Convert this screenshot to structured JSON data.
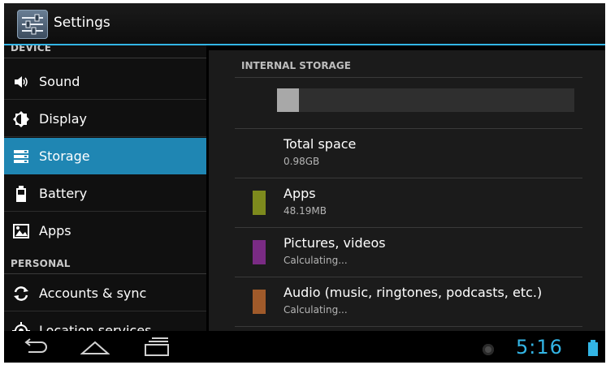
{
  "app": {
    "title": "Settings",
    "icon": "settings-sliders-icon"
  },
  "sidebar": {
    "sections": [
      {
        "header": "DEVICE"
      },
      {
        "header": "PERSONAL"
      }
    ],
    "items": [
      {
        "label": "Sound",
        "icon": "speaker-icon"
      },
      {
        "label": "Display",
        "icon": "brightness-icon"
      },
      {
        "label": "Storage",
        "icon": "storage-icon",
        "selected": true
      },
      {
        "label": "Battery",
        "icon": "battery-icon"
      },
      {
        "label": "Apps",
        "icon": "apps-icon"
      },
      {
        "label": "Accounts & sync",
        "icon": "sync-icon"
      },
      {
        "label": "Location services",
        "icon": "location-icon"
      }
    ]
  },
  "storage": {
    "header": "INTERNAL STORAGE",
    "used_fraction": 0.075,
    "rows": [
      {
        "title": "Total space",
        "sub": "0.98GB",
        "color": ""
      },
      {
        "title": "Apps",
        "sub": "48.19MB",
        "color": "#7d8a1d"
      },
      {
        "title": "Pictures, videos",
        "sub": "Calculating...",
        "color": "#7a2b84"
      },
      {
        "title": "Audio (music, ringtones, podcasts, etc.)",
        "sub": "Calculating...",
        "color": "#a05a2a"
      }
    ]
  },
  "statusbar": {
    "time": "5:16"
  },
  "colors": {
    "accent": "#33b5e5",
    "selected": "#1f86b3"
  }
}
